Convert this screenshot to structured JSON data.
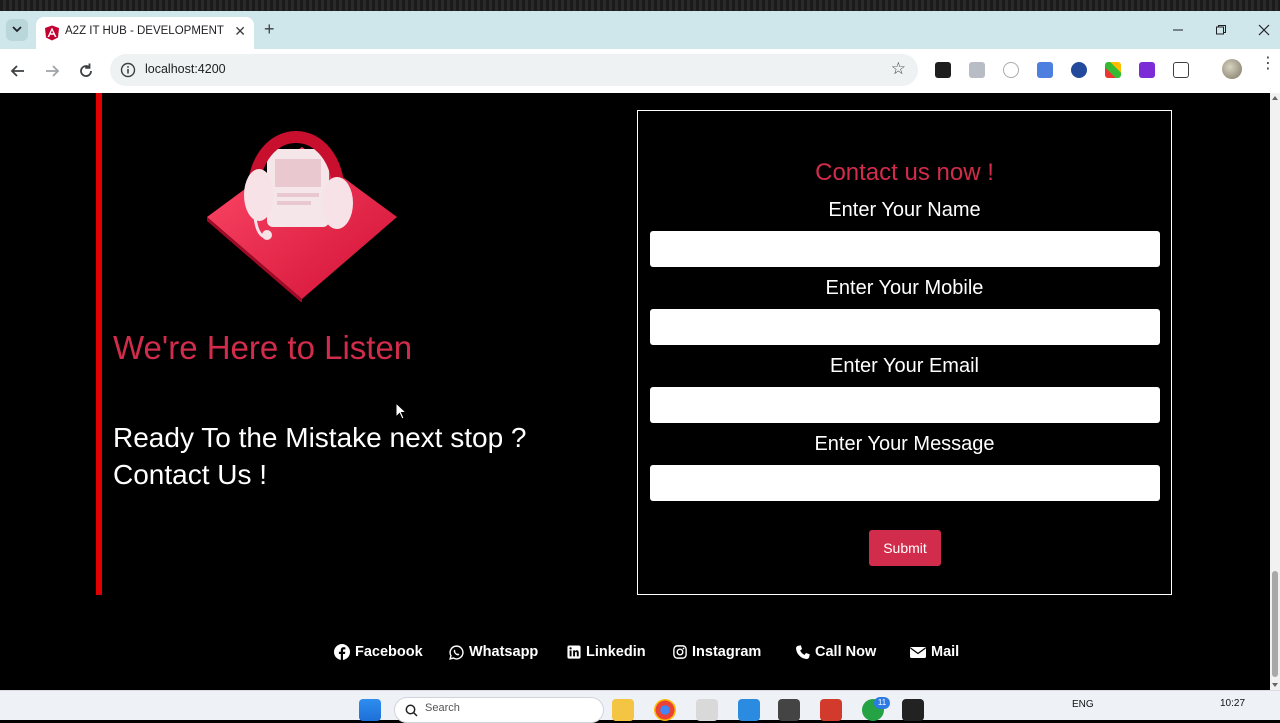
{
  "browser": {
    "tab_title": "A2Z IT HUB - DEVELOPMENT",
    "tab_close": "✕",
    "new_tab": "+",
    "url": "localhost:4200",
    "bookmark_star": "☆",
    "menu": "⋮"
  },
  "hero": {
    "heading": "We're Here to Listen",
    "subheading": "Ready To the Mistake next stop ? Contact Us !"
  },
  "form": {
    "title": "Contact us now !",
    "name_label": "Enter Your Name",
    "mobile_label": "Enter Your Mobile",
    "email_label": "Enter Your Email",
    "message_label": "Enter Your Message",
    "name_value": "",
    "mobile_value": "",
    "email_value": "",
    "message_value": "",
    "submit_label": "Submit"
  },
  "social": {
    "facebook": "Facebook",
    "whatsapp": "Whatsapp",
    "linkedin": "Linkedin",
    "instagram": "Instagram",
    "call": "Call Now",
    "mail": "Mail"
  },
  "taskbar": {
    "search_placeholder": "Search",
    "language": "ENG",
    "time": "10:27",
    "badge_count": "11"
  },
  "colors": {
    "accent": "#d12c4b",
    "side_bar": "#e00000",
    "tabbar_bg": "#cfe6ea"
  }
}
